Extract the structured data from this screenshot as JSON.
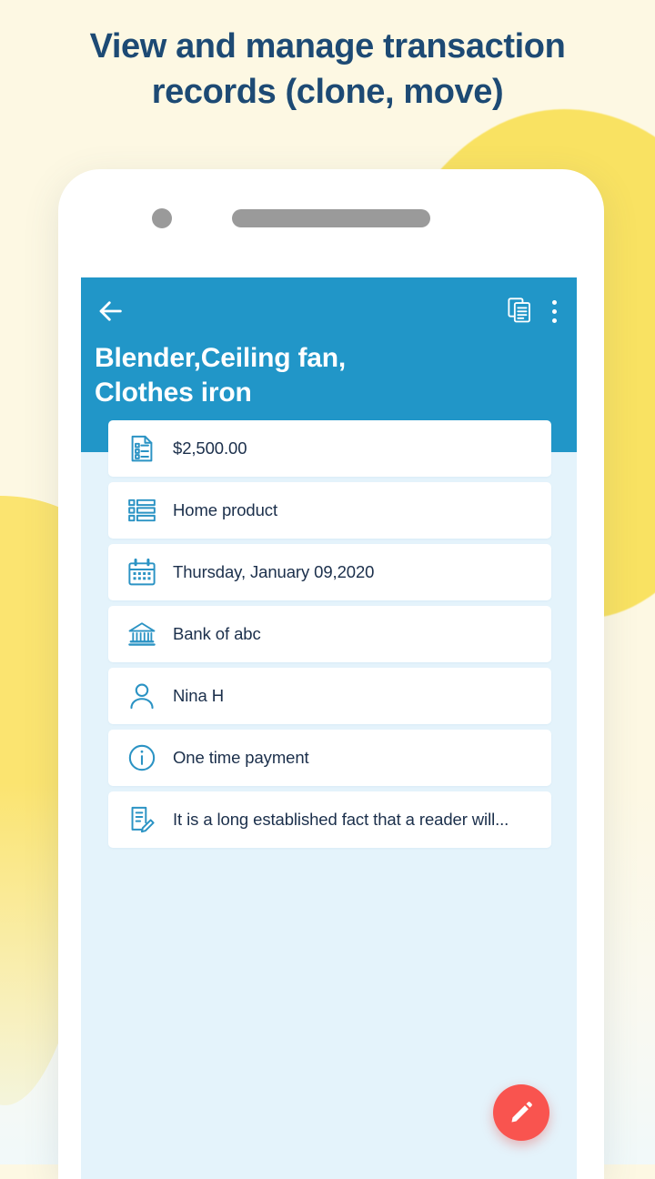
{
  "headline": "View and manage transaction records (clone, move)",
  "colors": {
    "page_background": "#fdf8e3",
    "blob_yellow": "#f9e262",
    "headline_text": "#1d4a74",
    "app_bar": "#2196c8",
    "screen_background": "#e4f3fb",
    "card": "#ffffff",
    "row_icon": "#2b93c4",
    "row_text": "#1b2f4b",
    "fab": "#f9544f"
  },
  "phone": {
    "camera_icon": "camera-dot",
    "speaker_icon": "speaker-grill"
  },
  "app": {
    "app_bar": {
      "back_icon": "arrow-left-icon",
      "clone_icon": "copy-icon",
      "overflow_icon": "more-vertical-icon",
      "title": "Blender,Ceiling fan,\nClothes iron"
    },
    "rows": [
      {
        "icon": "invoice-icon",
        "label": "$2,500.00"
      },
      {
        "icon": "list-icon",
        "label": "Home product"
      },
      {
        "icon": "calendar-icon",
        "label": "Thursday, January 09,2020"
      },
      {
        "icon": "bank-icon",
        "label": "Bank of abc"
      },
      {
        "icon": "person-icon",
        "label": "Nina H"
      },
      {
        "icon": "info-icon",
        "label": "One time payment"
      },
      {
        "icon": "note-edit-icon",
        "label": "It is a long established fact that a reader will..."
      }
    ],
    "fab": {
      "icon": "pencil-icon",
      "label": "Edit"
    }
  }
}
